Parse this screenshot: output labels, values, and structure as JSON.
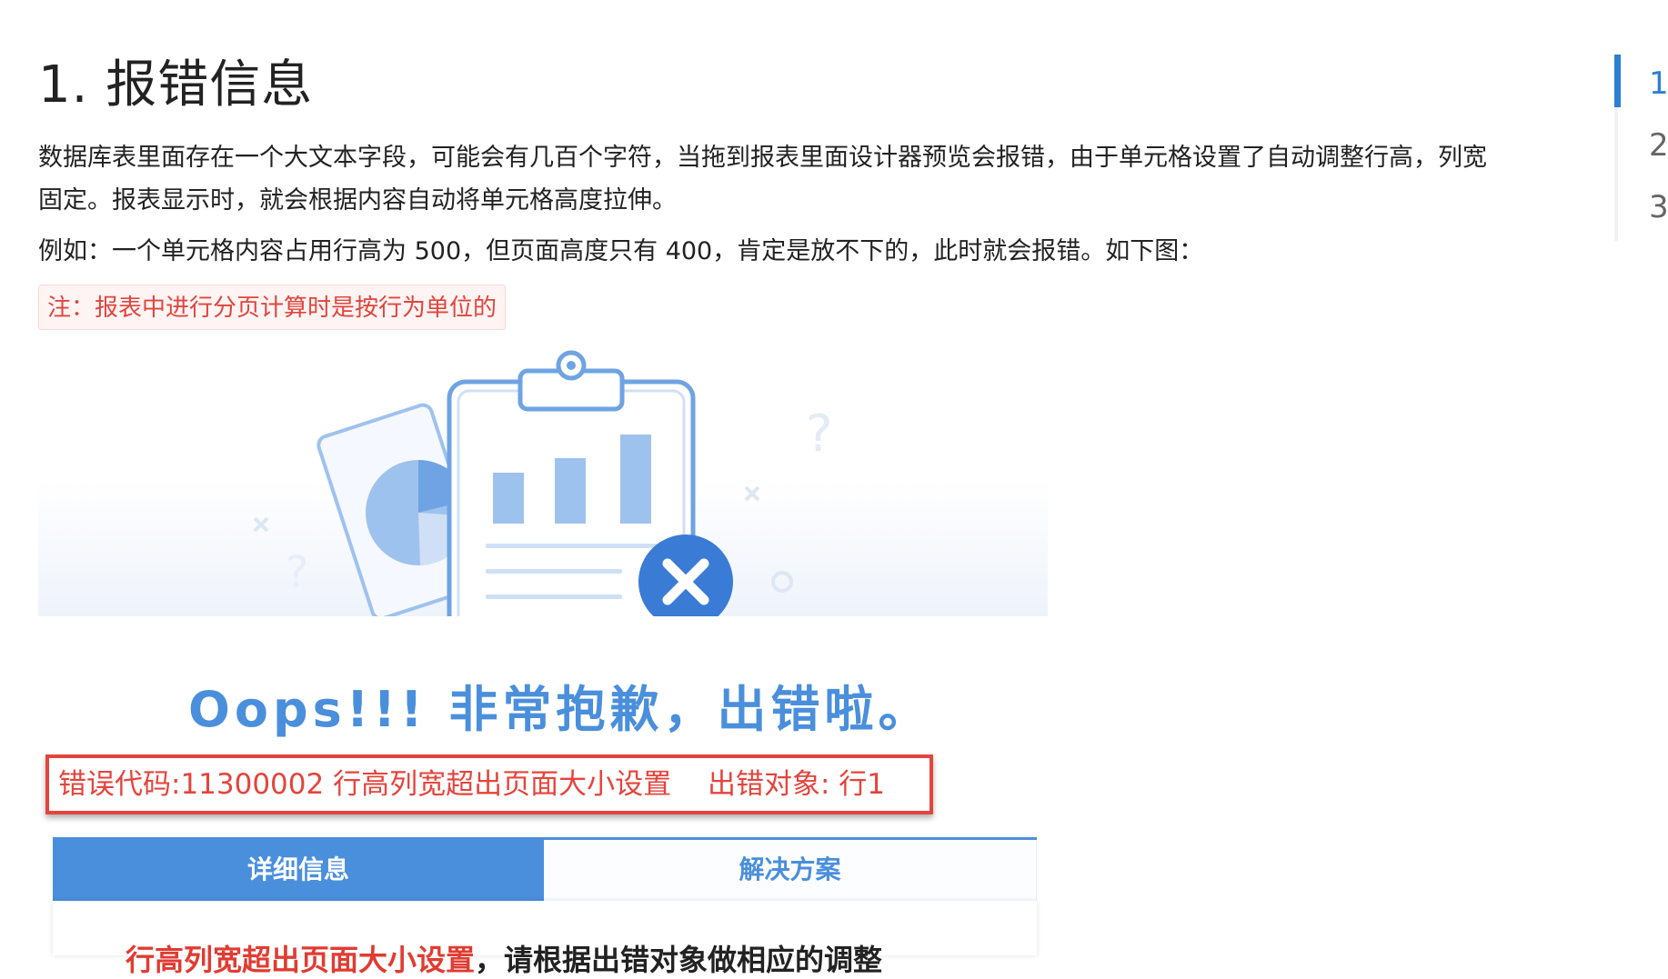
{
  "article": {
    "heading": "1. 报错信息",
    "paragraph1_line1": "数据库表里面存在一个大文本字段，可能会有几百个字符，当拖到报表里面设计器预览会报错，由于单元格设置了自动调整行高，列宽",
    "paragraph1_line2": "固定。报表显示时，就会根据内容自动将单元格高度拉伸。",
    "paragraph2": "例如：一个单元格内容占用行高为 500，但页面高度只有 400，肯定是放不下的，此时就会报错。如下图：",
    "note": "注：报表中进行分页计算时是按行为单位的"
  },
  "screenshot": {
    "oops_text": "Oops!!! 非常抱歉，出错啦。",
    "error_code": "错误代码:11300002 行高列宽超出页面大小设置",
    "error_object": "出错对象:    行1",
    "tabs": [
      "详细信息",
      "解决方案"
    ],
    "detail_message_red": "行高列宽超出页面大小设置",
    "detail_message_black": "，请根据出错对象做相应的调整"
  },
  "toc": {
    "items": [
      "1.",
      "2.",
      "3."
    ],
    "active_index": 0
  },
  "colors": {
    "accent": "#2d7fd4",
    "note_red": "#e0453c",
    "error_red": "#e5443c",
    "illustration_blue": "#4a8fdc"
  },
  "icons": [
    "clipboard-chart-icon",
    "pie-chart-card-icon",
    "error-x-circle-icon",
    "question-mark-icon",
    "cross-mark-icon"
  ]
}
